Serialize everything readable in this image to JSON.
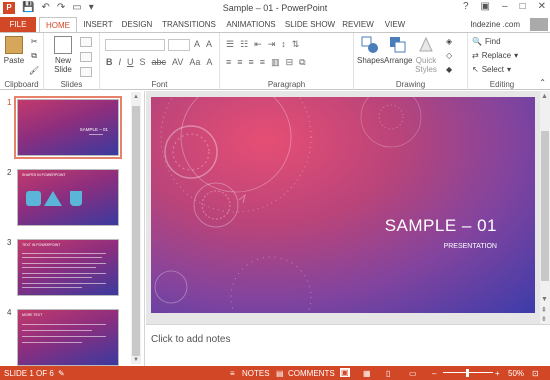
{
  "title": {
    "text": "Sample – 01 - PowerPoint"
  },
  "tabs": [
    "FILE",
    "HOME",
    "INSERT",
    "DESIGN",
    "TRANSITIONS",
    "ANIMATIONS",
    "SLIDE SHOW",
    "REVIEW",
    "VIEW"
  ],
  "user": {
    "name": "Indezine .com"
  },
  "ribbon": {
    "clipboard": {
      "label": "Clipboard",
      "paste": "Paste"
    },
    "slides": {
      "label": "Slides",
      "new_slide_1": "New",
      "new_slide_2": "Slide"
    },
    "font": {
      "label": "Font"
    },
    "paragraph": {
      "label": "Paragraph"
    },
    "drawing": {
      "label": "Drawing",
      "shapes": "Shapes",
      "arrange": "Arrange",
      "quick_1": "Quick",
      "quick_2": "Styles"
    },
    "editing": {
      "label": "Editing",
      "find": "Find",
      "replace": "Replace",
      "select": "Select"
    }
  },
  "thumbnails": [
    {
      "num": "1",
      "title": "SAMPLE – 01"
    },
    {
      "num": "2",
      "title": "SHAPES IN POWERPOINT"
    },
    {
      "num": "3",
      "title": "TEXT IN POWERPOINT"
    },
    {
      "num": "4",
      "title": "MORE TEXT"
    }
  ],
  "slide": {
    "title": "SAMPLE – 01",
    "subtitle": "PRESENTATION"
  },
  "notes": {
    "placeholder": "Click to add notes"
  },
  "status": {
    "slide": "SLIDE 1 OF 6",
    "notes": "NOTES",
    "comments": "COMMENTS",
    "zoom": "50%"
  },
  "colors": {
    "accent": "#d24726"
  }
}
